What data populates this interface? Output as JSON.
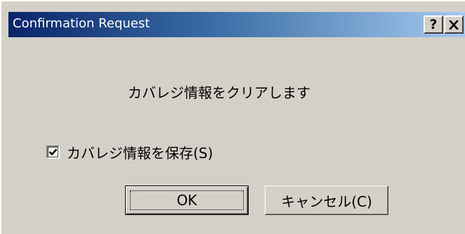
{
  "window": {
    "title": "Confirmation Request",
    "help_label": "?",
    "close_label": "✕"
  },
  "message": "カバレジ情報をクリアします",
  "save_checkbox": {
    "label": "カバレジ情報を保存(S)",
    "checked": true
  },
  "buttons": {
    "ok_label": "OK",
    "cancel_label": "キャンセル(C)"
  },
  "colors": {
    "titlebar_start": "#0a246a",
    "titlebar_end": "#a6caf0",
    "face": "#d4d0c8"
  },
  "icons": {
    "help": "help-icon",
    "close": "close-icon",
    "check": "check-icon"
  }
}
